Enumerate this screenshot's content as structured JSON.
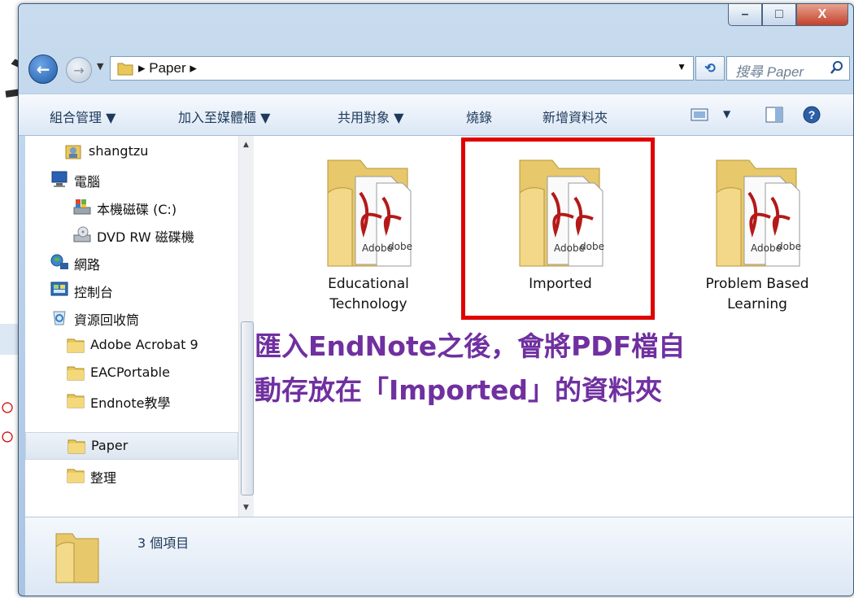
{
  "window": {
    "controls": {
      "minimize": "–",
      "maximize": "□",
      "close": "X"
    }
  },
  "address_bar": {
    "breadcrumb": "▸ Paper ▸",
    "dropdown": "▼",
    "refresh": "⟲",
    "search_placeholder": "搜尋 Paper"
  },
  "toolbar": {
    "organize": "組合管理 ▼",
    "add_to_library": "加入至媒體櫃 ▼",
    "share": "共用對象 ▼",
    "burn": "燒錄",
    "new_folder": "新增資料夾",
    "view_dropdown": "▼"
  },
  "nav_pane": {
    "items": [
      {
        "label": "shangtzu",
        "icon": "user-icon"
      },
      {
        "label": "電腦",
        "icon": "computer-icon"
      },
      {
        "label": "本機磁碟 (C:)",
        "icon": "local-disk-icon"
      },
      {
        "label": "DVD RW 磁碟機",
        "icon": "dvd-drive-icon"
      },
      {
        "label": "網路",
        "icon": "network-icon"
      },
      {
        "label": "控制台",
        "icon": "control-panel-icon"
      },
      {
        "label": "資源回收筒",
        "icon": "recycle-bin-icon"
      },
      {
        "label": "Adobe Acrobat 9",
        "icon": "folder-icon"
      },
      {
        "label": "EACPortable",
        "icon": "folder-icon"
      },
      {
        "label": "Endnote教學",
        "icon": "folder-icon"
      },
      {
        "label": "Paper",
        "icon": "folder-icon",
        "selected": true
      },
      {
        "label": "整理",
        "icon": "folder-icon"
      }
    ]
  },
  "folders": [
    {
      "line1": "Educational",
      "line2": "Technology"
    },
    {
      "line1": "Imported",
      "line2": "",
      "highlighted": true
    },
    {
      "line1": "Problem Based",
      "line2": "Learning"
    }
  ],
  "pdf_badge": {
    "left": "Adobe",
    "right": "dobe"
  },
  "annotation": {
    "line1": "匯入EndNote之後，會將PDF檔自",
    "line2": "動存放在「Imported」的資料夾"
  },
  "details": {
    "item_count": "3 個項目"
  },
  "colors": {
    "highlight": "#e00000",
    "annotation_text": "#7030a0",
    "titlebar": "#b8d0ea"
  }
}
